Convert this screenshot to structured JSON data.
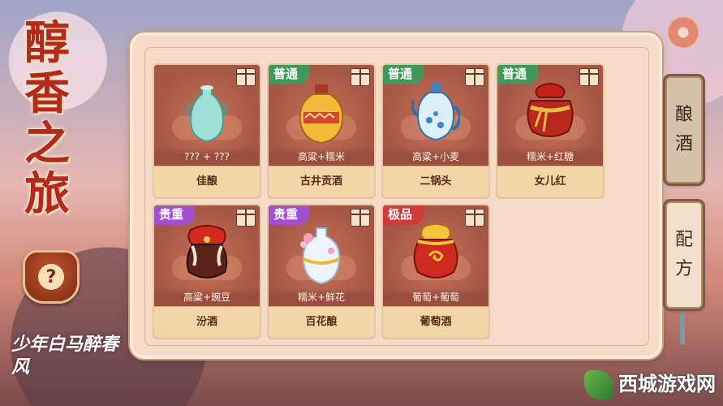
{
  "title": [
    "醇",
    "香",
    "之",
    "旅"
  ],
  "help_label": "?",
  "logo_text": "少年白马醉春风",
  "side_tabs": [
    {
      "label": [
        "酿",
        "酒"
      ],
      "active": true
    },
    {
      "label": [
        "配",
        "方"
      ],
      "active": false
    }
  ],
  "rarity_colors": {
    "普通": "#3f9a5a",
    "贵重": "#a24fd0",
    "极品": "#d03a3a"
  },
  "recipes": [
    {
      "badge": "",
      "ingredients": "??? + ???",
      "name": "佳酿",
      "vessel": "celadon-vase-icon"
    },
    {
      "badge": "普通",
      "ingredients": "高粱+糯米",
      "name": "古井贡酒",
      "vessel": "gold-jar-icon"
    },
    {
      "badge": "普通",
      "ingredients": "高粱+小麦",
      "name": "二锅头",
      "vessel": "blue-teapot-icon"
    },
    {
      "badge": "普通",
      "ingredients": "糯米+红糖",
      "name": "女儿红",
      "vessel": "red-jar-icon"
    },
    {
      "badge": "贵重",
      "ingredients": "高粱+豌豆",
      "name": "汾酒",
      "vessel": "dark-jar-icon"
    },
    {
      "badge": "贵重",
      "ingredients": "糯米+鲜花",
      "name": "百花酿",
      "vessel": "flower-vase-icon"
    },
    {
      "badge": "极品",
      "ingredients": "葡萄+葡萄",
      "name": "葡萄酒",
      "vessel": "gold-red-jar-icon"
    }
  ],
  "watermark": "西城游戏网"
}
